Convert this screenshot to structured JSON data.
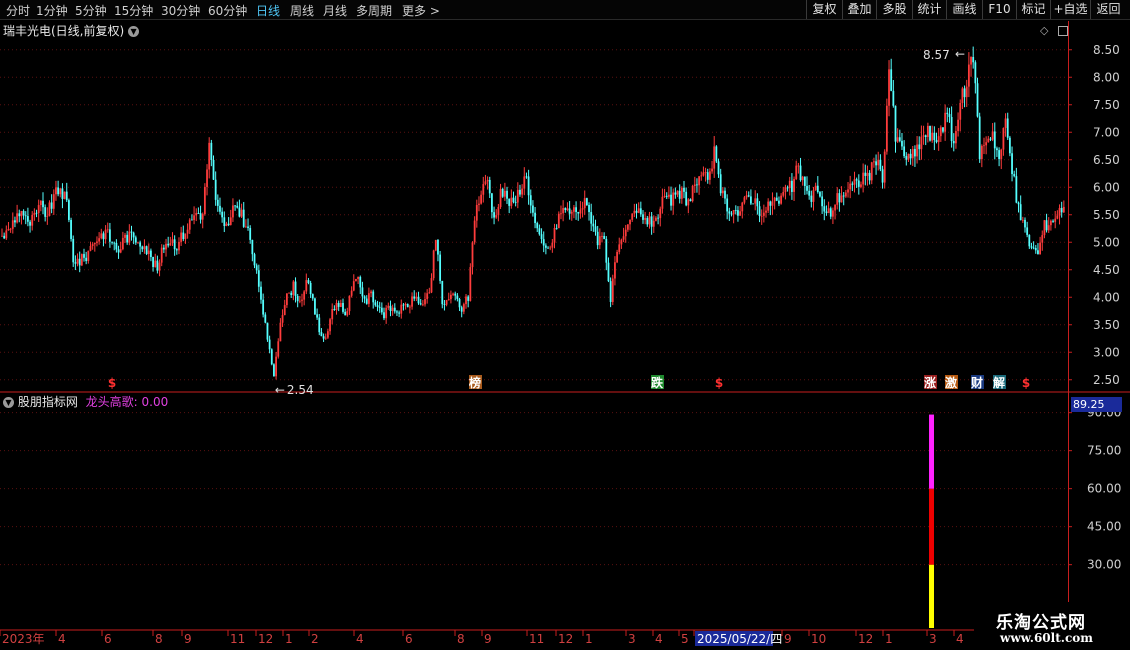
{
  "toolbar": {
    "periods": [
      "分时",
      "1分钟",
      "5分钟",
      "15分钟",
      "30分钟",
      "60分钟",
      "日线",
      "周线",
      "月线",
      "多周期",
      "更多"
    ],
    "active_period": "日线",
    "more_arrow": ">",
    "buttons": [
      "复权",
      "叠加",
      "多股",
      "统计",
      "画线",
      "F10",
      "标记",
      "+自选",
      "返回"
    ]
  },
  "stock": {
    "title": "瑞丰光电(日线,前复权)"
  },
  "indicator": {
    "name": "股朋指标网",
    "label_value": "龙头高歌: 0.00",
    "current_value": "89.25"
  },
  "brand": {
    "name": "乐淘公式网",
    "url": "www.60lt.com"
  },
  "colors": {
    "up": "#ff3c3c",
    "down": "#54ffff",
    "axis_red": "#c81e1e",
    "magenta": "#ff22ff",
    "red_bar": "#ee0000",
    "yellow_bar": "#ffff00"
  },
  "chart_data": {
    "type": "candlestick",
    "price_axis": {
      "ticks": [
        "8.50",
        "8.00",
        "7.50",
        "7.00",
        "6.50",
        "6.00",
        "5.50",
        "5.00",
        "4.50",
        "4.00",
        "3.50",
        "3.00",
        "2.50"
      ],
      "range": [
        2.35,
        8.75
      ]
    },
    "close_path": [
      5.1,
      5.2,
      5.45,
      5.6,
      5.3,
      5.45,
      5.65,
      5.5,
      5.8,
      6.0,
      5.7,
      4.7,
      4.65,
      4.75,
      5.0,
      5.1,
      5.2,
      5.0,
      4.85,
      5.1,
      5.1,
      5.05,
      4.95,
      4.7,
      4.5,
      4.95,
      5.05,
      4.95,
      5.15,
      5.35,
      5.55,
      5.5,
      6.8,
      5.7,
      5.4,
      5.25,
      5.7,
      5.5,
      5.2,
      4.6,
      4.0,
      3.2,
      2.6,
      3.6,
      4.0,
      4.2,
      3.9,
      4.3,
      3.9,
      3.4,
      3.2,
      3.8,
      3.9,
      3.7,
      4.1,
      4.4,
      3.9,
      4.05,
      3.85,
      3.7,
      3.8,
      3.75,
      3.8,
      3.9,
      4.0,
      3.85,
      4.05,
      5.1,
      3.85,
      4.0,
      4.0,
      3.8,
      4.0,
      5.5,
      5.9,
      6.15,
      5.4,
      5.95,
      5.8,
      5.65,
      6.0,
      6.2,
      5.5,
      5.05,
      4.85,
      5.0,
      5.5,
      5.6,
      5.55,
      5.6,
      5.7,
      5.45,
      5.05,
      5.1,
      3.95,
      4.85,
      5.0,
      5.4,
      5.55,
      5.5,
      5.35,
      5.45,
      5.7,
      5.75,
      5.8,
      5.9,
      5.75,
      6.05,
      6.1,
      6.2,
      6.6,
      5.9,
      5.65,
      5.6,
      5.5,
      5.85,
      5.8,
      5.6,
      5.55,
      5.8,
      5.7,
      5.95,
      6.0,
      6.4,
      5.9,
      5.85,
      6.0,
      5.5,
      5.55,
      5.8,
      5.9,
      6.0,
      6.05,
      6.2,
      6.25,
      6.5,
      6.1,
      8.2,
      6.9,
      6.7,
      6.5,
      6.6,
      6.9,
      7.0,
      6.8,
      7.1,
      7.3,
      6.8,
      7.5,
      7.9,
      8.45,
      6.6,
      6.9,
      7.0,
      6.5,
      7.2,
      6.3,
      5.6,
      5.2,
      4.9,
      4.8,
      5.3,
      5.4,
      5.5,
      5.7
    ],
    "annotations": [
      {
        "label": "8.57",
        "arrow": "←"
      },
      {
        "label": "2.54",
        "arrow": "←"
      }
    ],
    "event_markers": [
      {
        "text": "$",
        "color": "#ff3030"
      },
      {
        "text": "榜",
        "color": "#ffffff",
        "bg": "#a85a1c"
      },
      {
        "text": "跌",
        "color": "#ffffff",
        "bg": "#1f8a2e"
      },
      {
        "text": "$",
        "color": "#ff3030"
      },
      {
        "text": "涨",
        "color": "#ffffff",
        "bg": "#9a2020"
      },
      {
        "text": "激",
        "color": "#ffffff",
        "bg": "#b85a10"
      },
      {
        "text": "财",
        "color": "#ffffff",
        "bg": "#1a3a80"
      },
      {
        "text": "解",
        "color": "#ffffff",
        "bg": "#1a6a7a"
      },
      {
        "text": "$",
        "color": "#ff3030"
      }
    ],
    "indicator_axis": {
      "ticks": [
        "90.00",
        "75.00",
        "60.00",
        "45.00",
        "30.00"
      ],
      "range": [
        5,
        95
      ]
    },
    "indicator_bar": {
      "segments": [
        {
          "from": 5,
          "to": 30,
          "color": "#ffff00"
        },
        {
          "from": 30,
          "to": 60,
          "color": "#ee0000"
        },
        {
          "from": 60,
          "to": 89.25,
          "color": "#ff22ff"
        }
      ]
    },
    "time_axis": {
      "labels": [
        "2023年",
        "4",
        "6",
        "8",
        "9",
        "11",
        "12",
        "1",
        "2",
        "4",
        "6",
        "8",
        "9",
        "11",
        "12",
        "1",
        "3",
        "4",
        "5",
        "2025/05/22/四",
        "9",
        "10",
        "12",
        "1",
        "3",
        "4"
      ]
    }
  }
}
